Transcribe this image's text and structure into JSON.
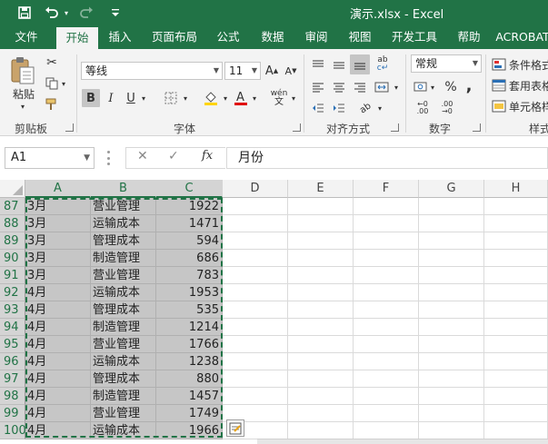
{
  "window": {
    "title": "演示.xlsx  -  Excel"
  },
  "colors": {
    "accent": "#217346",
    "ribbon_bg": "#f3f3f3",
    "selection": "#c6c6c6"
  },
  "quick_access": {
    "icons": [
      "save-icon",
      "undo-icon",
      "redo-icon",
      "customize-icon"
    ]
  },
  "tabs": [
    {
      "label": "文件",
      "active": false
    },
    {
      "label": "开始",
      "active": true
    },
    {
      "label": "插入",
      "active": false
    },
    {
      "label": "页面布局",
      "active": false
    },
    {
      "label": "公式",
      "active": false
    },
    {
      "label": "数据",
      "active": false
    },
    {
      "label": "审阅",
      "active": false
    },
    {
      "label": "视图",
      "active": false
    },
    {
      "label": "开发工具",
      "active": false
    },
    {
      "label": "帮助",
      "active": false
    },
    {
      "label": "ACROBAT",
      "active": false
    }
  ],
  "ribbon": {
    "clipboard": {
      "paste_label": "粘贴",
      "group_label": "剪贴板"
    },
    "font": {
      "font_name": "等线",
      "font_size": "11",
      "bold": "B",
      "italic": "I",
      "underline": "U",
      "group_label": "字体",
      "phonetic": "wén"
    },
    "alignment": {
      "group_label": "对齐方式"
    },
    "number": {
      "format": "常规",
      "group_label": "数字",
      "percent": "%",
      "comma": ","
    },
    "styles": {
      "conditional_format": "条件格式",
      "format_as_table": "套用表格",
      "cell_styles": "单元格样",
      "group_label": "样式"
    }
  },
  "formula_bar": {
    "name_box": "A1",
    "cancel": "✕",
    "enter": "✓",
    "fx": "fx",
    "content": "月份"
  },
  "sheet": {
    "columns": [
      "A",
      "B",
      "C",
      "D",
      "E",
      "F",
      "G",
      "H"
    ],
    "selected_columns": [
      "A",
      "B",
      "C"
    ],
    "rows": [
      {
        "row": "87",
        "a": "3月",
        "b": "营业管理",
        "c": "1922"
      },
      {
        "row": "88",
        "a": "3月",
        "b": "运输成本",
        "c": "1471"
      },
      {
        "row": "89",
        "a": "3月",
        "b": "管理成本",
        "c": "594"
      },
      {
        "row": "90",
        "a": "3月",
        "b": "制造管理",
        "c": "686"
      },
      {
        "row": "91",
        "a": "3月",
        "b": "营业管理",
        "c": "783"
      },
      {
        "row": "92",
        "a": "4月",
        "b": "运输成本",
        "c": "1953"
      },
      {
        "row": "93",
        "a": "4月",
        "b": "管理成本",
        "c": "535"
      },
      {
        "row": "94",
        "a": "4月",
        "b": "制造管理",
        "c": "1214"
      },
      {
        "row": "95",
        "a": "4月",
        "b": "营业管理",
        "c": "1766"
      },
      {
        "row": "96",
        "a": "4月",
        "b": "运输成本",
        "c": "1238"
      },
      {
        "row": "97",
        "a": "4月",
        "b": "管理成本",
        "c": "880"
      },
      {
        "row": "98",
        "a": "4月",
        "b": "制造管理",
        "c": "1457"
      },
      {
        "row": "99",
        "a": "4月",
        "b": "营业管理",
        "c": "1749"
      },
      {
        "row": "100",
        "a": "4月",
        "b": "运输成本",
        "c": "1966"
      }
    ]
  }
}
